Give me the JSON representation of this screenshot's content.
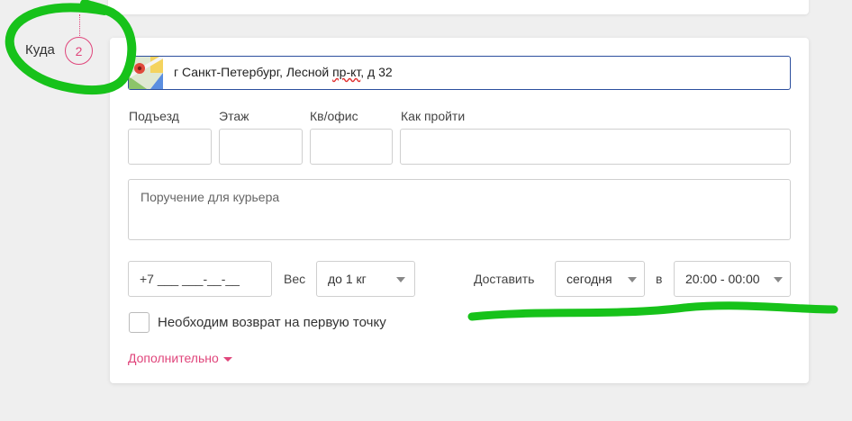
{
  "step": {
    "label": "Куда",
    "number": "2"
  },
  "address": {
    "prefix": "г Санкт-Петербург, Лесной ",
    "underlined": "пр-кт",
    "suffix": ", д 32"
  },
  "fields": {
    "entrance_label": "Подъезд",
    "floor_label": "Этаж",
    "apartment_label": "Кв/офис",
    "directions_label": "Как пройти",
    "instructions_placeholder": "Поручение для курьера"
  },
  "phone": {
    "value": "+7 ___ ___-__-__"
  },
  "weight": {
    "label": "Вес",
    "selected": "до 1 кг"
  },
  "delivery": {
    "label": "Доставить",
    "day": "сегодня",
    "at_label": "в",
    "time": "20:00 - 00:00"
  },
  "return_checkbox": {
    "label": "Необходим возврат на первую точку",
    "checked": false
  },
  "more_link": "Дополнительно",
  "colors": {
    "accent": "#e0457b",
    "focus_border": "#2c4f9e",
    "scribble": "#17c21a"
  }
}
